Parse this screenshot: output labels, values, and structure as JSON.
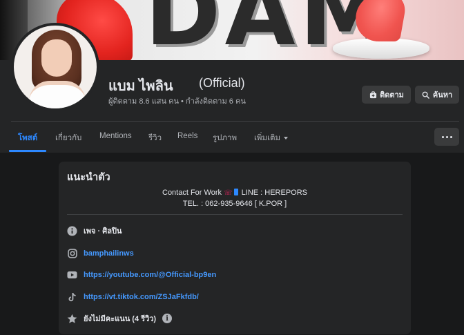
{
  "cover": {
    "word": "DAM"
  },
  "profile": {
    "name": "แบม ไพลิน",
    "suffix": "(Official)",
    "stats": "ผู้ติดตาม 8.6 แสน คน • กำลังติดตาม 6 คน"
  },
  "actions": {
    "follow_label": "ติดตาม",
    "follow_icon": "follow-icon",
    "search_label": "ค้นหา",
    "search_icon": "search-icon"
  },
  "tabs": [
    {
      "label": "โพสต์",
      "active": true
    },
    {
      "label": "เกี่ยวกับ"
    },
    {
      "label": "Mentions"
    },
    {
      "label": "รีวิว"
    },
    {
      "label": "Reels"
    },
    {
      "label": "รูปภาพ"
    },
    {
      "label": "เพิ่มเติม"
    }
  ],
  "intro": {
    "title": "แนะนำตัว",
    "bio_line1_prefix": "Contact For Work",
    "bio_line1_suffix": "LINE : HEREPORS",
    "bio_line2": "TEL. : 062-935-9646 [ K.POR ]",
    "category": "เพจ · ศิลปิน",
    "instagram": "bamphailinws",
    "youtube": "https://youtube.com/@Official-bp9en",
    "tiktok": "https://vt.tiktok.com/ZSJaFkfdb/",
    "reviews": "ยังไม่มีคะแนน (4 รีวิว)"
  },
  "colors": {
    "background": "#18191a",
    "surface": "#242526",
    "button": "#3a3b3c",
    "accent": "#2d88ff",
    "link": "#4599ff",
    "text_primary": "#e4e6eb",
    "text_secondary": "#b0b3b8"
  }
}
